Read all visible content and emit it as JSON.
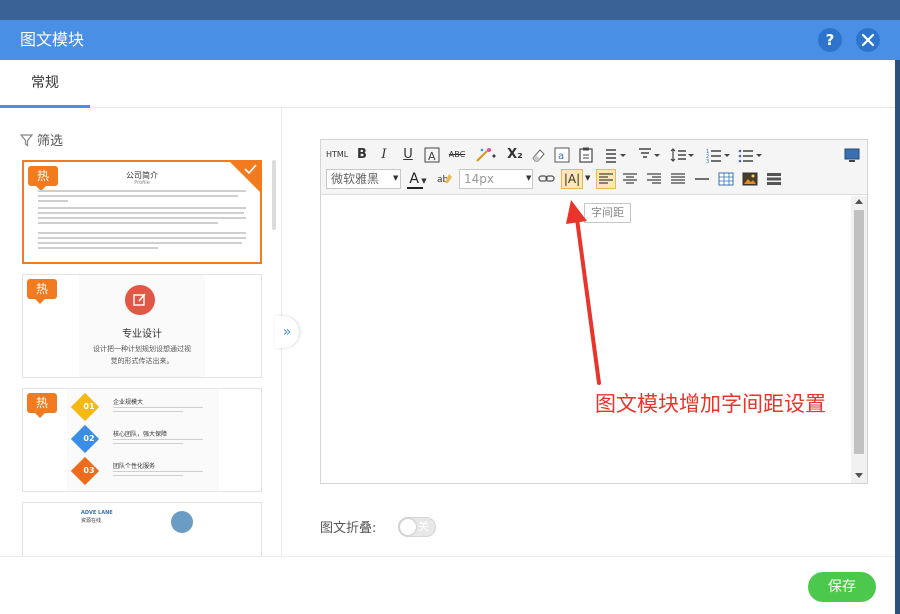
{
  "dialog": {
    "title": "图文模块",
    "help_symbol": "?"
  },
  "tabs": [
    {
      "label": "常规"
    }
  ],
  "sidebar": {
    "filter_label": "筛选",
    "hot_badge": "热",
    "collapse_symbol": "»",
    "templates": [
      {
        "title": "公司简介",
        "subtitle": "Profile"
      },
      {
        "title": "专业设计",
        "desc_line1": "设计把一种计划规划设想通过视",
        "desc_line2": "觉的形式传达出来。"
      },
      {
        "items": [
          {
            "num": "01",
            "title": "企业规模大"
          },
          {
            "num": "02",
            "title": "核心团队，强大保障"
          },
          {
            "num": "03",
            "title": "团队个性化服务"
          }
        ]
      },
      {
        "line1": "ADVE LANE",
        "line2": "资源在线"
      }
    ]
  },
  "editor": {
    "toolbar_row1": {
      "html_label": "HTML",
      "bold": "B",
      "italic": "I",
      "underline": "U",
      "strike": "ABC",
      "subscript": "X₂"
    },
    "toolbar_row2": {
      "font_family_value": "微软雅黑",
      "font_size_value": "14px",
      "font_color_glyph": "A",
      "letter_spacing_glyph": "|A|"
    },
    "tooltip": "字间距"
  },
  "annotation": "图文模块增加字间距设置",
  "fold": {
    "label": "图文折叠:",
    "toggle_state": "关"
  },
  "footer": {
    "save_label": "保存"
  },
  "colors": {
    "title_bar": "#4a8fe6",
    "accent_orange": "#f27b1f",
    "save_green": "#4cc94c",
    "annotation_red": "#e8342a"
  }
}
